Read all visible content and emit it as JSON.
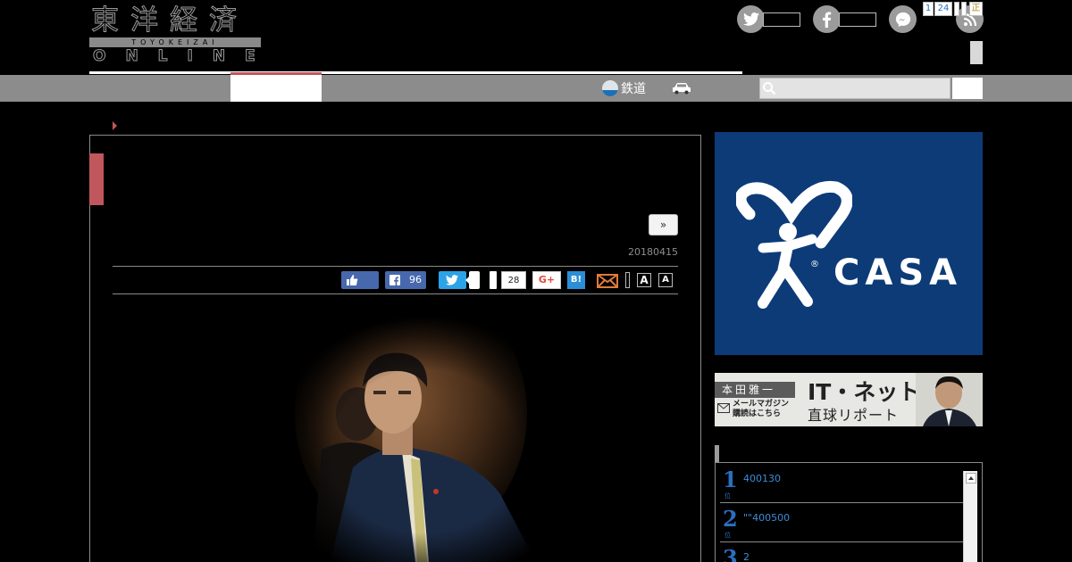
{
  "header": {
    "logo_kanji": "東洋経済",
    "logo_romaji": "TOYOKEIZAI",
    "logo_online": "ONLINE"
  },
  "nav": {
    "category_label": "鉄道",
    "search_placeholder": ""
  },
  "article": {
    "next_label": "»",
    "date": "20180415"
  },
  "share": {
    "facebook_count": "96",
    "pocket_count": "28",
    "gplus_label": "G+",
    "hatena_label": "B!",
    "font_large_label": "A",
    "font_small_label": "A"
  },
  "ads": {
    "casa_text": "CASA",
    "it_author": "本田雅一",
    "it_title": "IT・ネット",
    "it_subtitle": "直球リポート",
    "it_mail_line1": "メールマガジン",
    "it_mail_line2": "購読はこちら"
  },
  "ranking": {
    "tabs": [
      "1",
      "24",
      "",
      "",
      "正"
    ],
    "unit": "位",
    "items": [
      {
        "rank": "1",
        "text": "400130"
      },
      {
        "rank": "2",
        "text": "\"\"400500"
      },
      {
        "rank": "3",
        "text": "2"
      }
    ]
  },
  "colors": {
    "accent": "#c0575c",
    "nav_gray": "#8c8c8c",
    "casa_blue": "#0c3b78",
    "link_blue": "#2a6fc1"
  }
}
